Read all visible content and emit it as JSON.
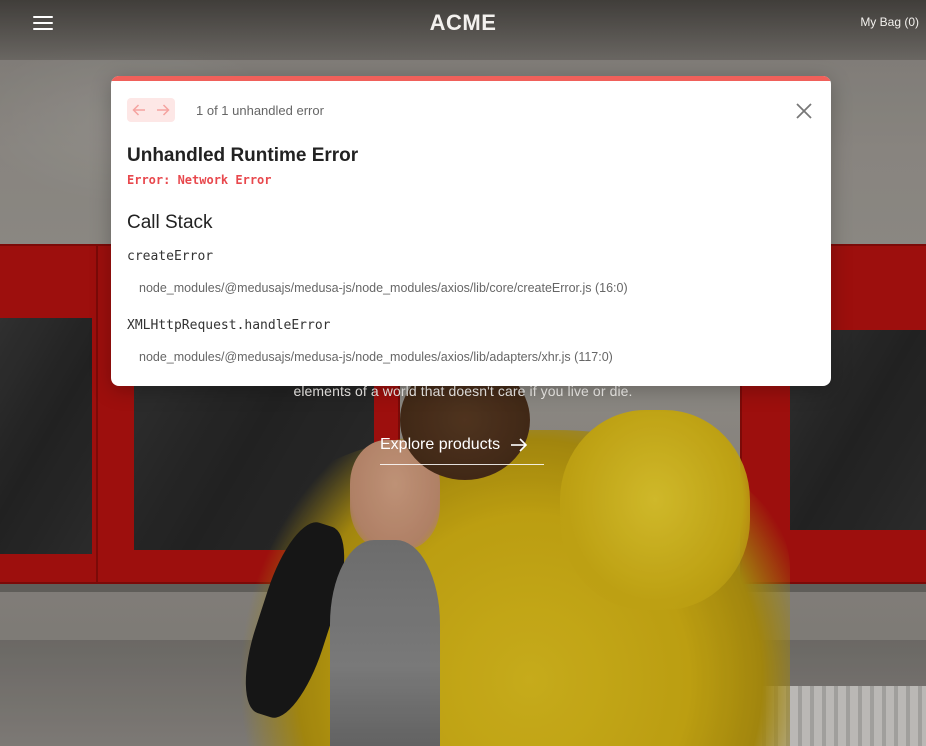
{
  "nav": {
    "brand": "ACME",
    "bag_label": "My Bag (0)"
  },
  "hero": {
    "tagline": "elements of a world that doesn't care if you live or die.",
    "cta_label": "Explore products"
  },
  "error_overlay": {
    "pagination_text": "1 of 1 unhandled error",
    "title": "Unhandled Runtime Error",
    "message": "Error: Network Error",
    "call_stack_heading": "Call Stack",
    "frames": [
      {
        "function": "createError",
        "location": "node_modules/@medusajs/medusa-js/node_modules/axios/lib/core/createError.js (16:0)"
      },
      {
        "function": "XMLHttpRequest.handleError",
        "location": "node_modules/@medusajs/medusa-js/node_modules/axios/lib/adapters/xhr.js (117:0)"
      }
    ],
    "accent_color": "#f0605a",
    "message_color": "#e8484d"
  },
  "icons": {
    "menu": "hamburger-icon",
    "previous": "arrow-left-icon",
    "next": "arrow-right-icon",
    "close": "close-icon",
    "cta": "arrow-right-icon"
  }
}
